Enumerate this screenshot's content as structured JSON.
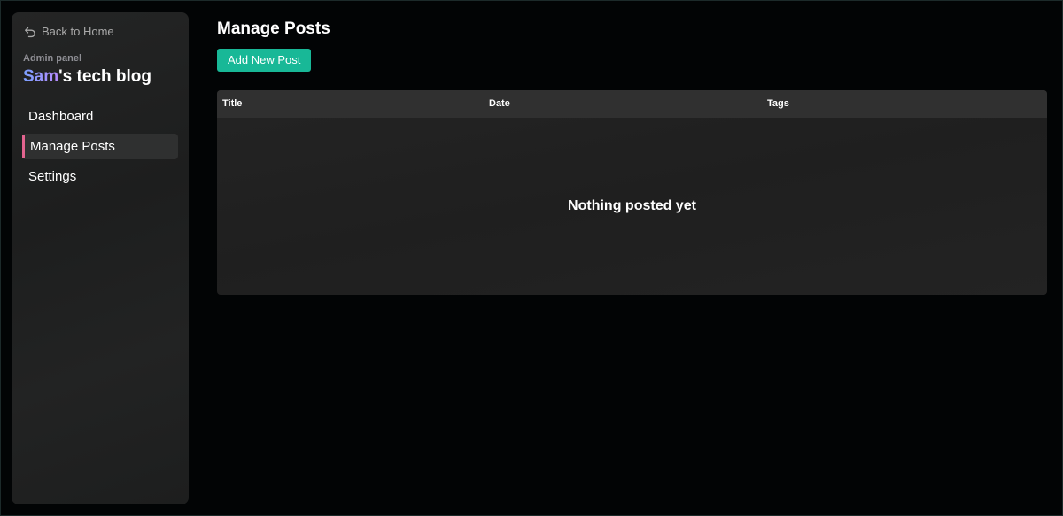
{
  "sidebar": {
    "back_label": "Back to Home",
    "admin_label": "Admin panel",
    "blog_title_accent": "Sam",
    "blog_title_rest": "'s tech blog",
    "items": [
      {
        "label": "Dashboard"
      },
      {
        "label": "Manage Posts",
        "active": true
      },
      {
        "label": "Settings"
      }
    ]
  },
  "main": {
    "title": "Manage Posts",
    "add_button_label": "Add New Post",
    "table": {
      "columns": [
        "Title",
        "Date",
        "Tags"
      ],
      "rows": [],
      "empty_message": "Nothing posted yet"
    }
  },
  "colors": {
    "accent_button": "#18b897",
    "active_indicator": "#e3648f",
    "title_gradient_start": "#7aa0ff",
    "title_gradient_end": "#b78cff"
  }
}
